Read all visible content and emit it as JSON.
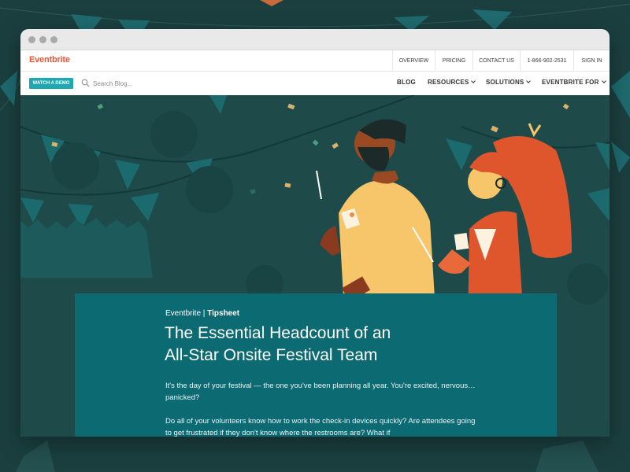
{
  "colors": {
    "page_bg": "#1b3f3f",
    "hero_bg": "#1e4a4a",
    "article_bg": "#0c6a73",
    "brand": "#f05537",
    "cta": "#1fa8b2"
  },
  "header": {
    "logo": "Eventbrite",
    "top_links": [
      "OVERVIEW",
      "PRICING",
      "CONTACT US",
      "1-866-902-2531",
      "SIGN IN"
    ]
  },
  "subnav": {
    "demo_label": "WATCH A DEMO",
    "search_placeholder": "Search Blog...",
    "search_icon": "search-icon",
    "items": [
      {
        "label": "BLOG",
        "dropdown": false
      },
      {
        "label": "RESOURCES",
        "dropdown": true
      },
      {
        "label": "SOLUTIONS",
        "dropdown": true
      },
      {
        "label": "EVENTBRITE FOR",
        "dropdown": true
      }
    ]
  },
  "article": {
    "brand": "Eventbrite",
    "separator": " | ",
    "category": "Tipsheet",
    "title_line1": "The Essential Headcount of an",
    "title_line2": "All-Star Onsite Festival Team",
    "paragraph1": "It's the day of your festival — the one you've been planning all year. You're excited, nervous… panicked?",
    "paragraph2": "Do all of your volunteers know how to work the check-in devices quickly? Are attendees going to get frustrated if they don't know where the restrooms are? What if"
  }
}
